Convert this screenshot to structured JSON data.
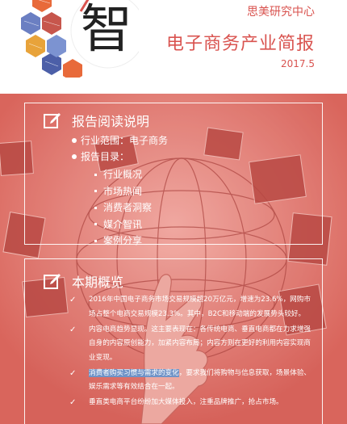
{
  "header": {
    "logo_char": "智",
    "org": "思美研究中心",
    "title": "电子商务产业简报",
    "date": "2017.5"
  },
  "colors": {
    "accent": "#d9534f",
    "background": "#e07a72",
    "highlight": "#6f93c7"
  },
  "icons": [
    "edit-icon",
    "check-icon"
  ],
  "panel1": {
    "title": "报告阅读说明",
    "bullets": [
      "行业范围：电子商务",
      "报告目录："
    ],
    "toc": [
      "行业概况",
      "市场热闻",
      "消费者洞察",
      "媒介智讯",
      "案例分享"
    ]
  },
  "panel2": {
    "title": "本期概览",
    "items": [
      {
        "text": "2016年中国电子商务市场交易规模超20万亿元，增速为23.6%，网购市场占整个电商交易规模23.3%。其中，B2C和移动端的发展势头较好。"
      },
      {
        "text": "内容电商趋势显现。这主要表现在：各传统电商、垂直电商都在力求增强自身的内容原创能力，加紧内容布局；内容方则在更好的利用内容实现商业变现。"
      },
      {
        "highlight": "消费者购买习惯与需求的变化",
        "text": "，要求我们将购物与信息获取，场景体验、娱乐需求等有效结合在一起。"
      },
      {
        "text": "垂直类电商平台纷纷加大媒体投入，注重品牌推广，抢占市场。"
      }
    ]
  }
}
